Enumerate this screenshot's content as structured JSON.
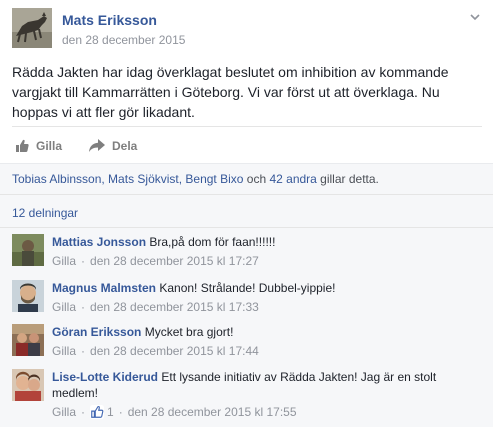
{
  "post": {
    "author": "Mats Eriksson",
    "date": "den 28 december 2015",
    "text": "Rädda Jakten har idag överklagat beslutet om inhibition av kommande vargjakt till Kammarrätten i Göteborg. Vi var först ut att överklaga. Nu hoppas vi att fler gör likadant.",
    "avatar_icon": "wolf-photo"
  },
  "actions": {
    "like_label": "Gilla",
    "share_label": "Dela"
  },
  "likes": {
    "names": "Tobias Albinsson, Mats Sjökvist, Bengt Bixo",
    "connector": " och ",
    "others": "42 andra",
    "suffix": " gillar detta."
  },
  "shares": {
    "label": "12 delningar"
  },
  "comments": [
    {
      "author": "Mattias Jonsson",
      "text": "Bra,på dom för faan!!!!!!",
      "like_label": "Gilla",
      "timestamp": "den 28 december 2015 kl 17:27",
      "like_count": ""
    },
    {
      "author": "Magnus Malmsten",
      "text": "Kanon! Strålande! Dubbel-yippie!",
      "like_label": "Gilla",
      "timestamp": "den 28 december 2015 kl 17:33",
      "like_count": ""
    },
    {
      "author": "Göran Eriksson",
      "text": "Mycket bra gjort!",
      "like_label": "Gilla",
      "timestamp": "den 28 december 2015 kl 17:44",
      "like_count": ""
    },
    {
      "author": "Lise-Lotte Kiderud",
      "text": "Ett lysande initiativ av Rädda Jakten! Jag är en stolt medlem!",
      "like_label": "Gilla",
      "timestamp": "den 28 december 2015 kl 17:55",
      "like_count": "1"
    }
  ],
  "colors": {
    "link": "#365899",
    "meta": "#90949c",
    "background_ufi": "#f6f7f9"
  }
}
